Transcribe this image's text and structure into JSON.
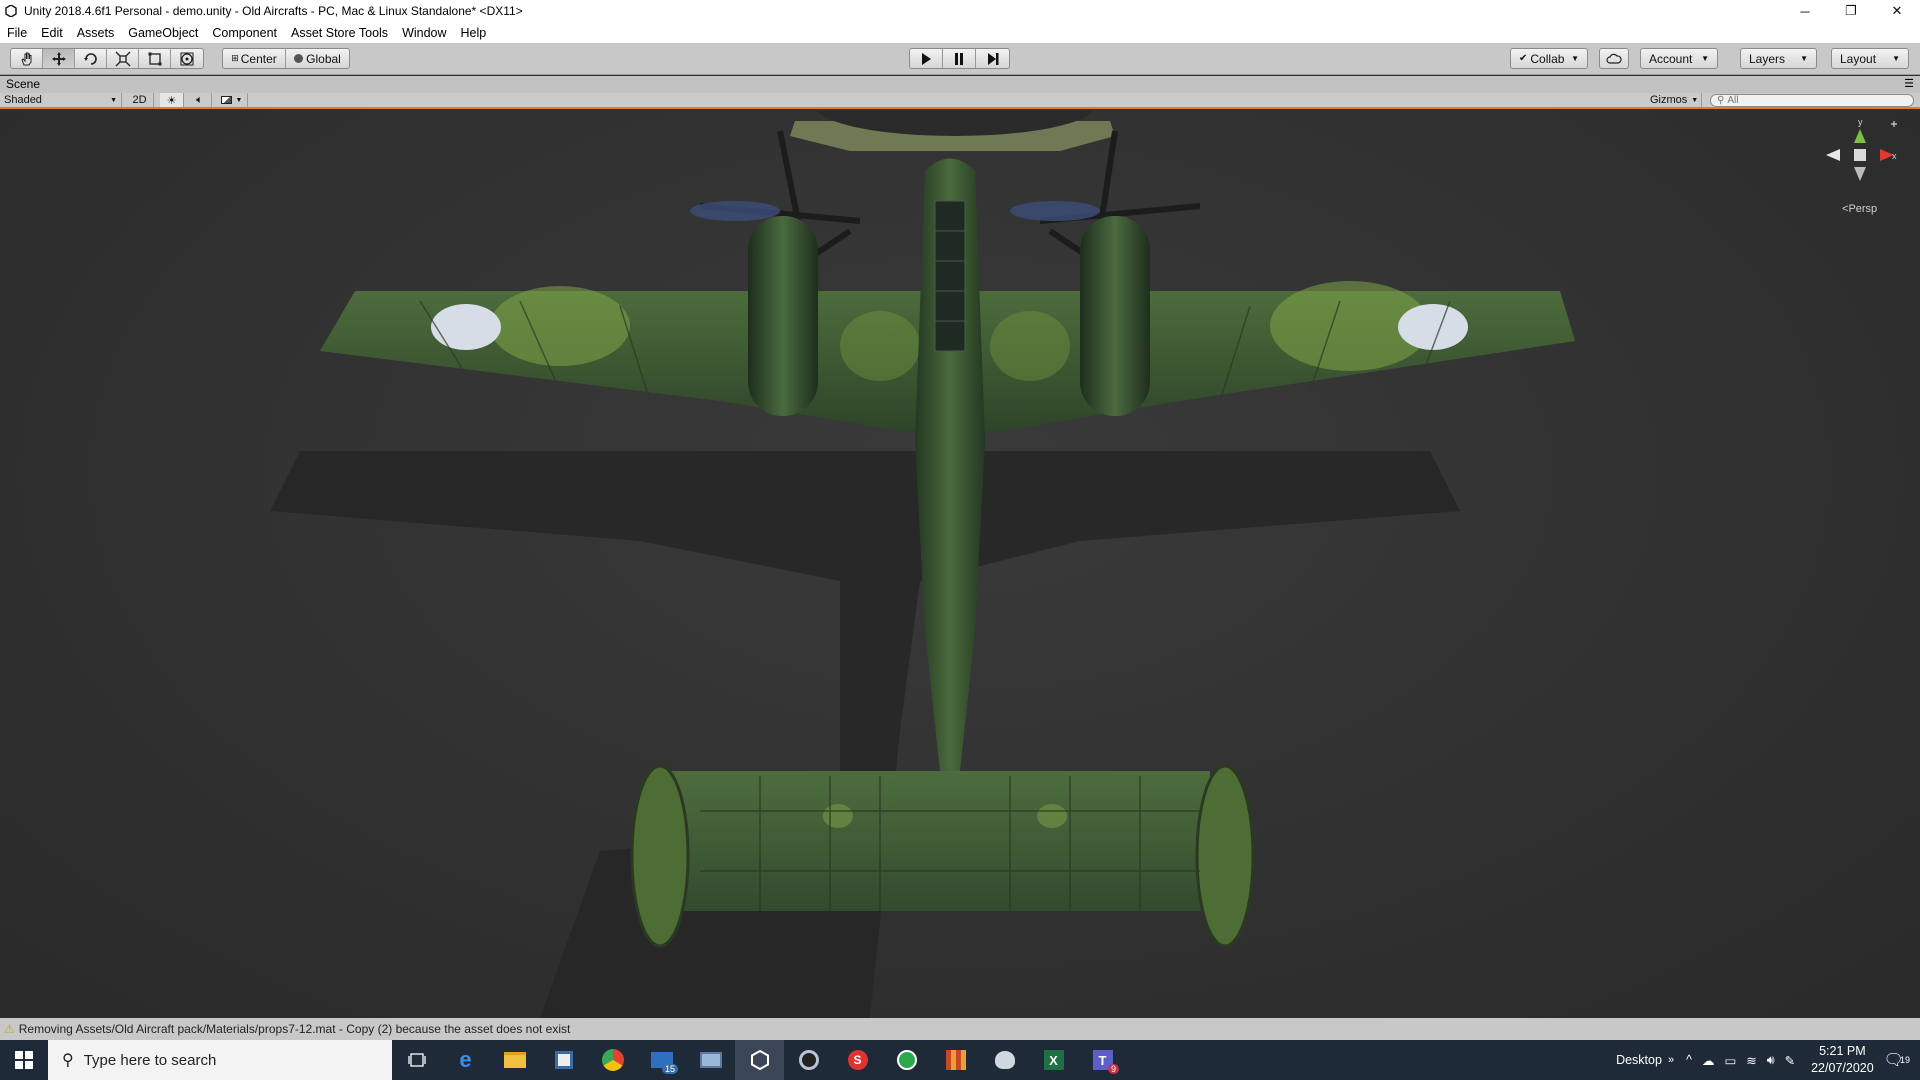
{
  "window": {
    "title": "Unity 2018.4.6f1 Personal - demo.unity - Old Aircrafts - PC, Mac & Linux Standalone* <DX11>",
    "minimize": "─",
    "restore": "❐",
    "close": "✕"
  },
  "menu": [
    "File",
    "Edit",
    "Assets",
    "GameObject",
    "Component",
    "Asset Store Tools",
    "Window",
    "Help"
  ],
  "toolbar": {
    "pivot": "Center",
    "space": "Global",
    "collab": "Collab",
    "account": "Account",
    "layers": "Layers",
    "layout": "Layout"
  },
  "scene": {
    "tab": "Scene",
    "draw_mode": "Shaded",
    "mode_2d": "2D",
    "gizmos": "Gizmos",
    "search_placeholder": "All",
    "axis_y": "y",
    "axis_x": "x",
    "projection": "Persp"
  },
  "status": {
    "message": "Removing Assets/Old Aircraft pack/Materials/props7-12.mat - Copy (2) because the asset does not exist"
  },
  "taskbar": {
    "search_placeholder": "Type here to search",
    "mail_badge": "15",
    "teams_badge": "9",
    "desktop_label": "Desktop",
    "time": "5:21 PM",
    "date": "22/07/2020",
    "notifications": "19"
  },
  "colors": {
    "accent_orange": "#e07b2c",
    "plane_green": "#3f5a36",
    "camo_light": "#7fa447"
  }
}
